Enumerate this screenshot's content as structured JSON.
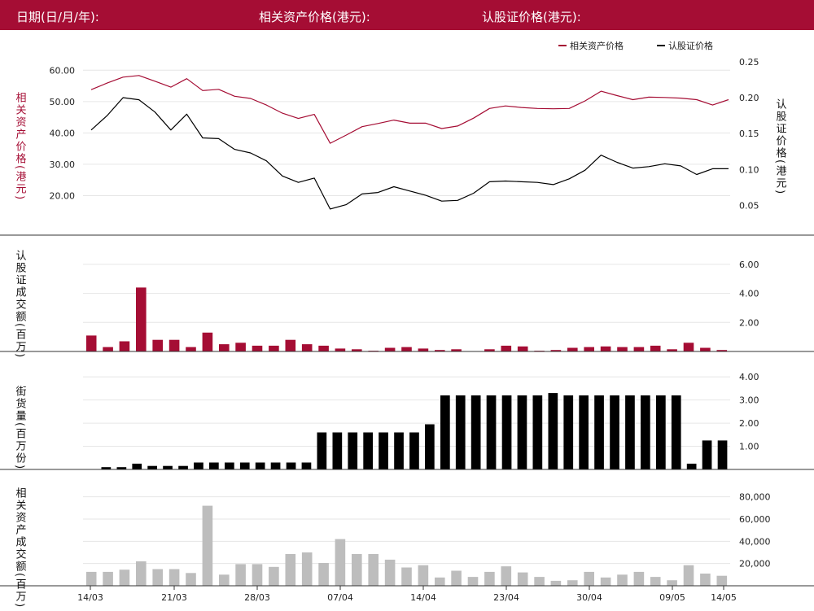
{
  "header": {
    "date_label": "日期(日/月/年):",
    "asset_price_label": "相关资产价格(港元):",
    "warrant_price_label": "认股证价格(港元):"
  },
  "colors": {
    "accent": "#a50d34",
    "warrant": "#000000",
    "turnover_asset": "#bdbdbd",
    "grid": "#e6e6e6"
  },
  "chart_data": [
    {
      "type": "line",
      "panel": "price",
      "x": [
        "14/03",
        "15/03",
        "16/03",
        "17/03",
        "18/03",
        "19/03",
        "20/03",
        "21/03",
        "22/03",
        "23/03",
        "24/03",
        "25/03",
        "26/03",
        "27/03",
        "28/03",
        "29/03",
        "30/03",
        "31/03",
        "01/04",
        "02/04",
        "03/04",
        "04/04",
        "05/04",
        "06/04",
        "07/04",
        "08/04",
        "09/04",
        "10/04",
        "11/04",
        "12/04",
        "13/04",
        "14/04",
        "15/04",
        "16/04",
        "17/04",
        "18/04",
        "19/04",
        "20/04",
        "21/04",
        "22/04",
        "23/04",
        "24/04",
        "25/04",
        "26/04",
        "27/04",
        "28/04",
        "29/04",
        "30/04",
        "01/05",
        "02/05",
        "03/05",
        "04/05",
        "05/05",
        "06/05",
        "07/05",
        "08/05",
        "09/05",
        "10/05",
        "11/05",
        "12/05",
        "13/05",
        "14/05"
      ],
      "series": [
        {
          "name": "相关资产价格",
          "axis": "left",
          "values": [
            53.8,
            55.9,
            57.8,
            58.3,
            56.5,
            54.6,
            57.3,
            53.5,
            53.9,
            51.7,
            51.0,
            48.9,
            46.3,
            44.6,
            45.9,
            36.7,
            39.3,
            42.0,
            43.0,
            44.1,
            43.1,
            43.1,
            41.4,
            42.2,
            44.7,
            47.8,
            48.6,
            48.1,
            47.8,
            47.7,
            47.8,
            50.2,
            53.3,
            51.9,
            50.6,
            51.4,
            51.3,
            51.1,
            50.6,
            48.9,
            50.6
          ]
        },
        {
          "name": "认股证价格",
          "axis": "right",
          "values": [
            0.155,
            0.175,
            0.2,
            0.197,
            0.18,
            0.155,
            0.177,
            0.144,
            0.143,
            0.128,
            0.123,
            0.112,
            0.091,
            0.082,
            0.088,
            0.045,
            0.051,
            0.066,
            0.068,
            0.076,
            0.07,
            0.064,
            0.056,
            0.057,
            0.067,
            0.083,
            0.084,
            0.083,
            0.082,
            0.079,
            0.087,
            0.099,
            0.12,
            0.11,
            0.102,
            0.104,
            0.108,
            0.105,
            0.093,
            0.101,
            0.101
          ]
        }
      ],
      "left_axis": {
        "label": "相关资产价格(港元)",
        "ticks": [
          "20.00",
          "30.00",
          "40.00",
          "50.00",
          "60.00"
        ],
        "ylim": [
          10,
          65
        ]
      },
      "right_axis": {
        "label": "认股证价格(港元)",
        "ticks": [
          "0.05",
          "0.10",
          "0.15",
          "0.20",
          "0.25"
        ],
        "ylim": [
          0.02,
          0.26
        ]
      },
      "legend": {
        "placement": "top-right",
        "entries": [
          "相关资产价格",
          "认股证价格"
        ]
      },
      "grid": true
    },
    {
      "type": "bar",
      "panel": "warrant_turnover",
      "label": "认股证成交额(百万)",
      "ticks": [
        "2.00",
        "4.00",
        "6.00"
      ],
      "ylim": [
        0,
        7
      ],
      "values": [
        1.1,
        0.3,
        0.7,
        4.4,
        0.8,
        0.8,
        0.3,
        1.3,
        0.5,
        0.6,
        0.4,
        0.4,
        0.8,
        0.5,
        0.4,
        0.2,
        0.15,
        0.05,
        0.25,
        0.3,
        0.2,
        0.1,
        0.15,
        0,
        0.15,
        0.4,
        0.35,
        0.05,
        0.1,
        0.25,
        0.3,
        0.35,
        0.3,
        0.3,
        0.4,
        0.15,
        0.6,
        0.25,
        0.1
      ]
    },
    {
      "type": "bar",
      "panel": "outstanding",
      "label": "街货量(百万份)",
      "ticks": [
        "1.00",
        "2.00",
        "3.00",
        "4.00"
      ],
      "ylim": [
        0,
        4.5
      ],
      "values": [
        0,
        0.1,
        0.1,
        0.25,
        0.15,
        0.15,
        0.15,
        0.3,
        0.3,
        0.3,
        0.3,
        0.3,
        0.3,
        0.3,
        0.3,
        1.6,
        1.6,
        1.6,
        1.6,
        1.6,
        1.6,
        1.6,
        1.95,
        3.2,
        3.2,
        3.2,
        3.2,
        3.2,
        3.2,
        3.2,
        3.3,
        3.2,
        3.2,
        3.2,
        3.2,
        3.2,
        3.2,
        3.2,
        3.2,
        0.25,
        1.25,
        1.25
      ]
    },
    {
      "type": "bar",
      "panel": "asset_turnover",
      "label": "相关资产成交额(百万)",
      "ticks": [
        "20,000",
        "40,000",
        "60,000",
        "80,000"
      ],
      "ylim": [
        0,
        90000
      ],
      "x_ticks": [
        "14/03",
        "21/03",
        "28/03",
        "07/04",
        "14/04",
        "23/04",
        "30/04",
        "09/05",
        "14/05"
      ],
      "values": [
        12500,
        12500,
        14500,
        22000,
        15000,
        15000,
        11500,
        72000,
        10000,
        19500,
        19500,
        17000,
        28500,
        30000,
        20500,
        42000,
        28500,
        28500,
        23500,
        16500,
        18500,
        7500,
        13500,
        8000,
        12500,
        17500,
        12000,
        8000,
        4500,
        5000,
        12500,
        7500,
        10000,
        12500,
        8000,
        5000,
        18500,
        11000,
        9000
      ]
    }
  ]
}
